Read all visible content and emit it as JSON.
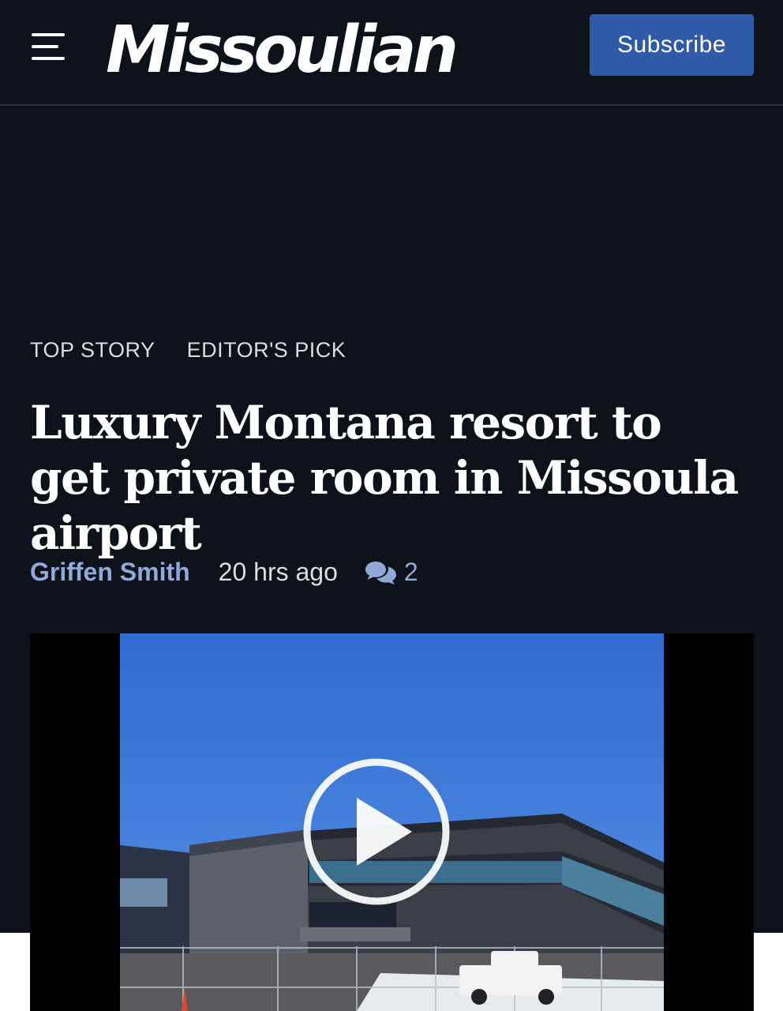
{
  "header": {
    "logo_text": "Missoulian",
    "subscribe_label": "Subscribe",
    "menu_icon": "hamburger-menu-icon"
  },
  "article": {
    "tags": [
      "TOP STORY",
      "EDITOR'S PICK"
    ],
    "headline": "Luxury Montana resort to get private room in Missoula airport",
    "author": "Griffen Smith",
    "time_ago": "20 hrs ago",
    "comment_count": "2",
    "comment_icon": "comments-icon"
  },
  "media": {
    "type": "video",
    "play_icon": "play-icon",
    "description_icon": "airport-terminal-thumbnail"
  },
  "colors": {
    "background": "#0c111a",
    "subscribe_button": "#2f5aa8",
    "link_accent": "#8fa9d8"
  }
}
